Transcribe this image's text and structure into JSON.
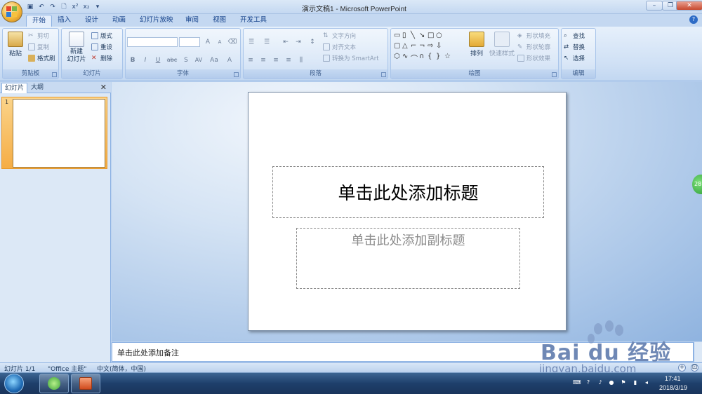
{
  "window": {
    "title": "演示文稿1 - Microsoft PowerPoint"
  },
  "tabs": [
    "开始",
    "插入",
    "设计",
    "动画",
    "幻灯片放映",
    "审阅",
    "视图",
    "开发工具"
  ],
  "ribbon": {
    "clipboard": {
      "label": "剪贴板",
      "paste": "粘贴",
      "cut": "剪切",
      "copy": "复制",
      "format_painter": "格式刷"
    },
    "slides": {
      "label": "幻灯片",
      "new_slide_line1": "新建",
      "new_slide_line2": "幻灯片",
      "layout": "版式",
      "reset": "重设",
      "delete": "删除"
    },
    "font": {
      "label": "字体",
      "bold": "B",
      "italic": "I",
      "underline": "U",
      "strike": "abc",
      "shadow": "S",
      "spacing": "AV",
      "case": "Aa",
      "grow": "A",
      "shrink": "A",
      "color": "A"
    },
    "paragraph": {
      "label": "段落",
      "text_direction": "文字方向",
      "align_text": "对齐文本",
      "smartart": "转换为 SmartArt"
    },
    "drawing": {
      "label": "绘图",
      "arrange": "排列",
      "quick_styles": "快速样式",
      "shape_fill": "形状填充",
      "shape_outline": "形状轮廓",
      "shape_effects": "形状效果"
    },
    "editing": {
      "label": "编辑",
      "find": "查找",
      "replace": "替换",
      "select": "选择"
    }
  },
  "left_pane": {
    "tab_slides": "幻灯片",
    "tab_outline": "大纲",
    "close": "✕",
    "slide_number": "1"
  },
  "slide": {
    "title_placeholder": "单击此处添加标题",
    "subtitle_placeholder": "单击此处添加副标题"
  },
  "notes": {
    "placeholder": "单击此处添加备注"
  },
  "side_badge": "28",
  "status": {
    "slide_info": "幻灯片 1/1",
    "theme": "\"Office 主题\"",
    "language": "中文(简体，中国)"
  },
  "watermark": {
    "brand": "Bai du 经验",
    "url": "jingyan.baidu.com"
  },
  "taskbar": {
    "time": "17:41",
    "date": "2018/3/19"
  },
  "icons": [
    "office-button",
    "save-icon",
    "undo-icon",
    "redo-icon",
    "help-icon",
    "paste-icon",
    "scissors-icon",
    "copy-icon",
    "brush-icon",
    "find-icon",
    "replace-icon",
    "select-icon",
    "windows-start-icon",
    "ie-icon",
    "powerpoint-icon"
  ]
}
